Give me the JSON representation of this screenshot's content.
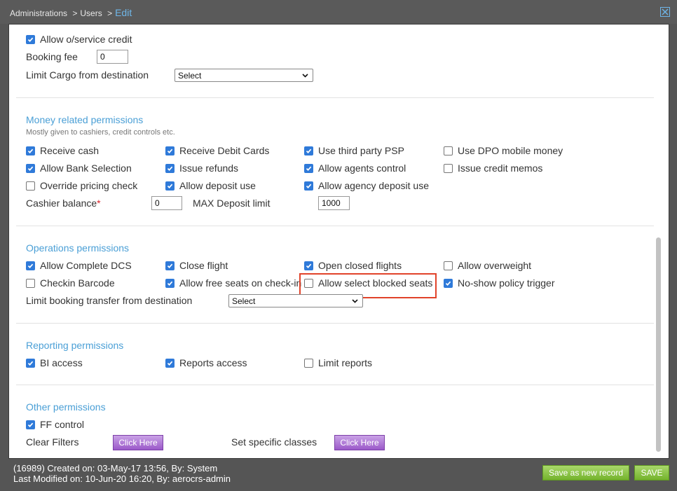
{
  "breadcrumb": {
    "root": "Administrations",
    "sep": ">",
    "users": "Users",
    "current": "Edit"
  },
  "colors": {
    "accent": "#4a9fd6",
    "checkbox": "#2f7ad9",
    "highlight": "#e1432a",
    "save": "#74b32d",
    "purple": "#9b59c9"
  },
  "top": {
    "allow_service_credit": {
      "label": "Allow o/service credit",
      "checked": true
    },
    "booking_fee_label": "Booking fee",
    "booking_fee_value": "0",
    "limit_cargo_label": "Limit Cargo from destination",
    "limit_cargo_value": "Select"
  },
  "money": {
    "title": "Money related permissions",
    "subtitle": "Mostly given to cashiers, credit controls etc.",
    "checkboxes": [
      {
        "label": "Receive cash",
        "checked": true
      },
      {
        "label": "Receive Debit Cards",
        "checked": true
      },
      {
        "label": "Use third party PSP",
        "checked": true
      },
      {
        "label": "Use DPO mobile money",
        "checked": false
      },
      {
        "label": "Allow Bank Selection",
        "checked": true
      },
      {
        "label": "Issue refunds",
        "checked": true
      },
      {
        "label": "Allow agents control",
        "checked": true
      },
      {
        "label": "Issue credit memos",
        "checked": false
      },
      {
        "label": "Override pricing check",
        "checked": false
      },
      {
        "label": "Allow deposit use",
        "checked": true
      },
      {
        "label": "Allow agency deposit use",
        "checked": true
      }
    ],
    "cashier_balance_label": "Cashier balance",
    "cashier_balance_required": "*",
    "cashier_balance_value": "0",
    "max_deposit_label": "MAX Deposit limit",
    "max_deposit_value": "1000"
  },
  "operations": {
    "title": "Operations permissions",
    "checkboxes": [
      {
        "label": "Allow Complete DCS",
        "checked": true
      },
      {
        "label": "Close flight",
        "checked": true
      },
      {
        "label": "Open closed flights",
        "checked": true
      },
      {
        "label": "Allow overweight",
        "checked": false
      },
      {
        "label": "Checkin Barcode",
        "checked": false
      },
      {
        "label": "Allow free seats on check-in",
        "checked": true
      },
      {
        "label": "Allow select blocked seats",
        "checked": false
      },
      {
        "label": "No-show policy trigger",
        "checked": true
      }
    ],
    "limit_transfer_label": "Limit booking transfer from destination",
    "limit_transfer_value": "Select"
  },
  "reporting": {
    "title": "Reporting permissions",
    "checkboxes": [
      {
        "label": "BI access",
        "checked": true
      },
      {
        "label": "Reports access",
        "checked": true
      },
      {
        "label": "Limit reports",
        "checked": false
      }
    ]
  },
  "other": {
    "title": "Other permissions",
    "ff_control": {
      "label": "FF control",
      "checked": true
    },
    "clear_filters_label": "Clear Filters",
    "clear_filters_button": "Click Here",
    "specific_classes_label": "Set specific classes",
    "specific_classes_button": "Click Here"
  },
  "footer": {
    "created": "(16989) Created on: 03-May-17 13:56, By: System",
    "modified": "Last Modified on: 10-Jun-20 16:20, By: aerocrs-admin",
    "save_new_label": "Save as new record",
    "save_label": "SAVE"
  }
}
